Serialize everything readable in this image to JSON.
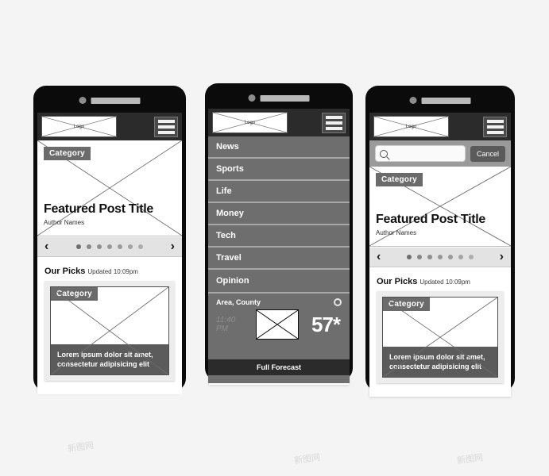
{
  "meta": {
    "title": "Mobile News App Wireframe Mockups",
    "watermark": "新图网"
  },
  "common": {
    "logo_label": "Logo",
    "category_chip": "Category",
    "featured_title": "Featured Post Title",
    "featured_author": "Author Names",
    "picks_title": "Our Picks",
    "picks_updated": "Updated 10:09pm",
    "card_caption": "Lorem ipsum dolor sit amet, consectetur adipisicing elit",
    "arrow_prev": "‹",
    "arrow_next": "›",
    "carousel_dots": [
      "#6e6e6e",
      "#868686",
      "#8f8f8f",
      "#989898",
      "#9a9a9a",
      "#a3a3a3",
      "#adadad"
    ],
    "icons": {
      "hamburger": "hamburger-menu-icon",
      "search": "search-icon",
      "gear": "gear-icon",
      "image_placeholder": "image-placeholder-icon"
    }
  },
  "phone1": {
    "name": "Home screen"
  },
  "phone2": {
    "name": "Navigation menu screen",
    "nav_items": [
      {
        "label": "News"
      },
      {
        "label": "Sports"
      },
      {
        "label": "Life"
      },
      {
        "label": "Money"
      },
      {
        "label": "Tech"
      },
      {
        "label": "Travel"
      },
      {
        "label": "Opinion"
      }
    ],
    "weather": {
      "location": "Area, County",
      "time_line1": "11:40",
      "time_line2": "PM",
      "temperature": "57*"
    },
    "full_forecast": "Full Forecast"
  },
  "phone3": {
    "name": "Search screen",
    "search_placeholder": "",
    "search_value": "",
    "cancel_label": "Cancel"
  },
  "colors": {
    "page_bg": "#f4f4f4",
    "phone_body": "#0b0b0b",
    "topbar": "#2b2b2b",
    "chip": "#6b6b6b",
    "nav_item": "#6e6e6e",
    "nav_divider": "#a6a6a6",
    "caption": "#5b5b5b",
    "carousel": "#e3e3e3",
    "search_bar": "#9a9a9a"
  }
}
